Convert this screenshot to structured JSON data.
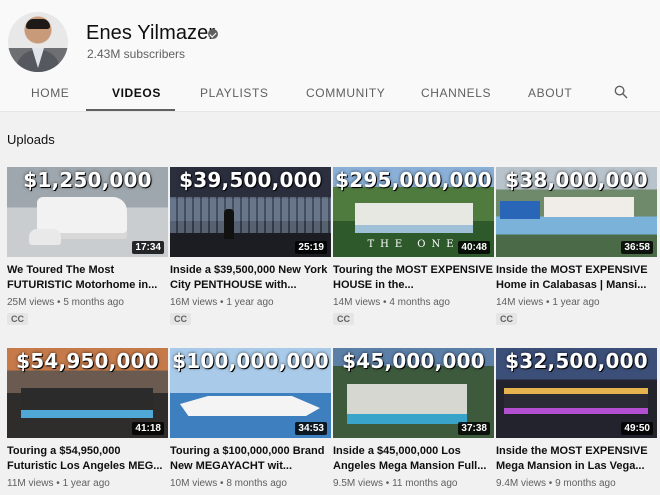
{
  "channel": {
    "name": "Enes Yilmazer",
    "subscribers": "2.43M subscribers"
  },
  "tabs": [
    {
      "label": "HOME"
    },
    {
      "label": "VIDEOS"
    },
    {
      "label": "PLAYLISTS"
    },
    {
      "label": "COMMUNITY"
    },
    {
      "label": "CHANNELS"
    },
    {
      "label": "ABOUT"
    }
  ],
  "active_tab": "VIDEOS",
  "section": {
    "title": "Uploads"
  },
  "videos": [
    {
      "price": "$1,250,000",
      "duration": "17:34",
      "title": "We Toured The Most FUTURISTIC Motorhome in...",
      "views": "25M views",
      "age": "5 months ago",
      "badge": "CC"
    },
    {
      "price": "$39,500,000",
      "duration": "25:19",
      "title": "Inside a $39,500,000 New York City PENTHOUSE with...",
      "views": "16M views",
      "age": "1 year ago",
      "badge": "CC"
    },
    {
      "price": "$295,000,000",
      "duration": "40:48",
      "watermark": "THE ONE",
      "title": "Touring the MOST EXPENSIVE HOUSE in the...",
      "views": "14M views",
      "age": "4 months ago",
      "badge": "CC"
    },
    {
      "price": "$38,000,000",
      "duration": "36:58",
      "title": "Inside the MOST EXPENSIVE Home in Calabasas | Mansi...",
      "views": "14M views",
      "age": "1 year ago",
      "badge": "CC"
    },
    {
      "price": "$54,950,000",
      "duration": "41:18",
      "title": "Touring a $54,950,000 Futuristic Los Angeles MEG...",
      "views": "11M views",
      "age": "1 year ago"
    },
    {
      "price": "$100,000,000",
      "duration": "34:53",
      "title": "Touring a $100,000,000 Brand New MEGAYACHT wit...",
      "views": "10M views",
      "age": "8 months ago"
    },
    {
      "price": "$45,000,000",
      "duration": "37:38",
      "title": "Inside a $45,000,000 Los Angeles Mega Mansion Full...",
      "views": "9.5M views",
      "age": "11 months ago"
    },
    {
      "price": "$32,500,000",
      "duration": "49:50",
      "title": "Inside the MOST EXPENSIVE Mega Mansion in Las Vega...",
      "views": "9.4M views",
      "age": "9 months ago"
    }
  ],
  "colors": {
    "background": "#f9f9f9",
    "content_background": "#f1f1f1",
    "text_primary": "#0f0f0f",
    "text_secondary": "#606060"
  }
}
